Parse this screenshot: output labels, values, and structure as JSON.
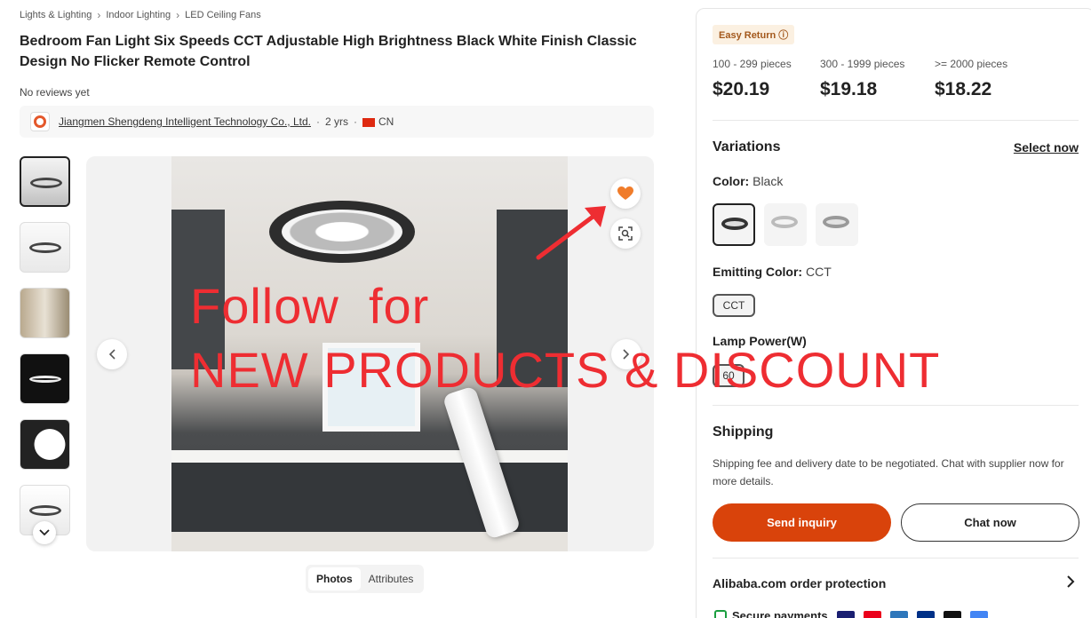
{
  "breadcrumb": [
    "Lights & Lighting",
    "Indoor Lighting",
    "LED Ceiling Fans"
  ],
  "product": {
    "title": "Bedroom Fan Light Six Speeds CCT Adjustable High Brightness Black White Finish Classic Design No Flicker Remote Control",
    "reviews": "No reviews yet"
  },
  "supplier": {
    "name": "Jiangmen Shengdeng Intelligent Technology Co., Ltd.",
    "years": "2 yrs",
    "country": "CN"
  },
  "gallery": {
    "tabs": [
      "Photos",
      "Attributes"
    ],
    "active_tab": "Photos"
  },
  "overlay": {
    "line1": "Follow  for",
    "line2": "NEW PRODUCTS & DISCOUNT"
  },
  "panel": {
    "badge": "Easy Return",
    "tiers": [
      {
        "qty": "100 - 299 pieces",
        "price": "$20.19"
      },
      {
        "qty": "300 - 1999 pieces",
        "price": "$19.18"
      },
      {
        "qty": ">= 2000 pieces",
        "price": "$18.22"
      }
    ],
    "variations_title": "Variations",
    "select_now": "Select now",
    "color_label": "Color:",
    "color_value": "Black",
    "emitting_label": "Emitting Color:",
    "emitting_value": "CCT",
    "emitting_option": "CCT",
    "lamp_label": "Lamp Power(W)",
    "lamp_option": "60",
    "shipping_title": "Shipping",
    "shipping_text": "Shipping fee and delivery date to be negotiated. Chat with supplier now for more details.",
    "inquiry_button": "Send inquiry",
    "chat_button": "Chat now",
    "protection": "Alibaba.com order protection",
    "secure": "Secure payments"
  },
  "colors": {
    "accent": "#d9430b",
    "overlay_red": "#ee2d32",
    "heart": "#f07c2a"
  }
}
